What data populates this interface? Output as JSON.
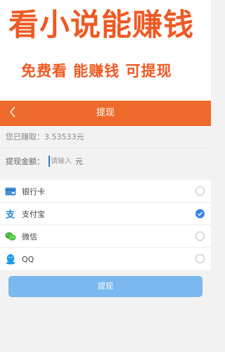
{
  "promo": {
    "title": "看小说能赚钱",
    "subtitle": "免费看  能赚钱  可提现"
  },
  "navbar": {
    "title": "提现",
    "back_icon": "chevron-left-icon"
  },
  "form": {
    "earned_label": "您已赚取：",
    "earned_value": "3.53533元",
    "amount_label": "提现金额：",
    "amount_placeholder": "请输入",
    "amount_unit": "元"
  },
  "payment_methods": [
    {
      "label": "银行卡",
      "icon": "bank-card-icon",
      "selected": false
    },
    {
      "label": "支付宝",
      "icon": "alipay-icon",
      "selected": true
    },
    {
      "label": "微信",
      "icon": "wechat-icon",
      "selected": false
    },
    {
      "label": "QQ",
      "icon": "qq-icon",
      "selected": false
    }
  ],
  "submit_label": "提现",
  "colors": {
    "accent": "#ee6a2c",
    "promo_text": "#ee5a24",
    "radio_checked": "#3b82e0",
    "button": "#7ab8ef"
  }
}
